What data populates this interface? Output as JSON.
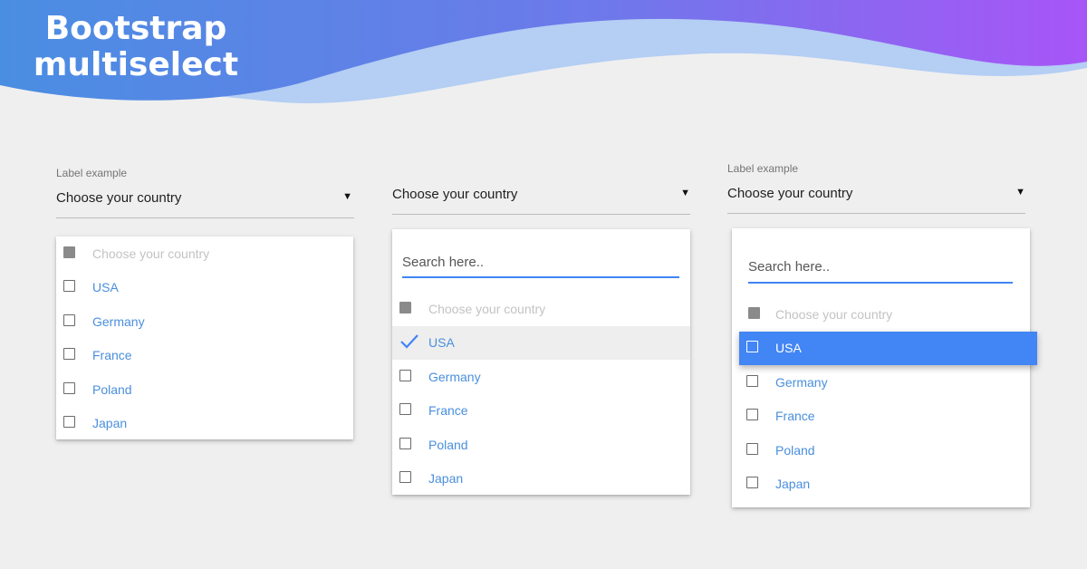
{
  "header": {
    "title_line1": "Bootstrap",
    "title_line2": "multiselect",
    "gradient_start": "#4a8ee2",
    "gradient_end": "#a855f7"
  },
  "examples": [
    {
      "label": "Label example",
      "selected_value": "Choose your country",
      "options": [
        {
          "label": "Choose your country",
          "state": "disabled"
        },
        {
          "label": "USA",
          "state": "unchecked"
        },
        {
          "label": "Germany",
          "state": "unchecked"
        },
        {
          "label": "France",
          "state": "unchecked"
        },
        {
          "label": "Poland",
          "state": "unchecked"
        },
        {
          "label": "Japan",
          "state": "unchecked"
        }
      ]
    },
    {
      "selected_value": "Choose your country",
      "search_placeholder": "Search here..",
      "options": [
        {
          "label": "Choose your country",
          "state": "disabled"
        },
        {
          "label": "USA",
          "state": "checked"
        },
        {
          "label": "Germany",
          "state": "unchecked"
        },
        {
          "label": "France",
          "state": "unchecked"
        },
        {
          "label": "Poland",
          "state": "unchecked"
        },
        {
          "label": "Japan",
          "state": "unchecked"
        }
      ]
    },
    {
      "label": "Label example",
      "selected_value": "Choose your country",
      "search_placeholder": "Search here..",
      "options": [
        {
          "label": "Choose your country",
          "state": "disabled"
        },
        {
          "label": "USA",
          "state": "active"
        },
        {
          "label": "Germany",
          "state": "unchecked"
        },
        {
          "label": "France",
          "state": "unchecked"
        },
        {
          "label": "Poland",
          "state": "unchecked"
        },
        {
          "label": "Japan",
          "state": "unchecked"
        }
      ]
    }
  ],
  "colors": {
    "accent": "#4285f4",
    "option_text": "#4a8fdc",
    "disabled_text": "#c3c3c3",
    "background": "#efefef"
  },
  "icons": {
    "caret": "caret-down-icon",
    "checkbox": "checkbox-icon",
    "check": "checkmark-icon"
  }
}
